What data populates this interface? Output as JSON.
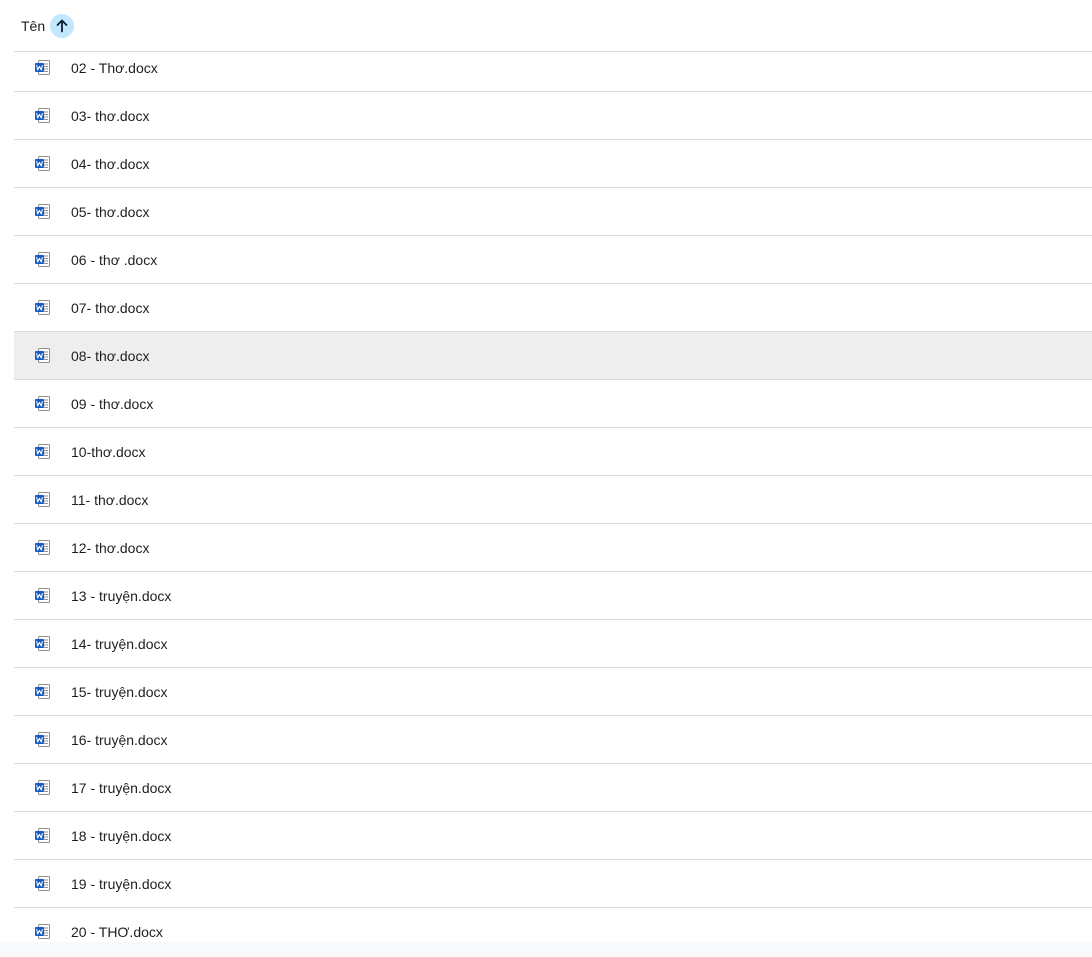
{
  "header": {
    "column_label": "Tên",
    "sort_icon": "arrow-up-icon"
  },
  "files": [
    {
      "name": "02 - Thơ.docx",
      "icon": "word-doc-icon"
    },
    {
      "name": "03- thơ.docx",
      "icon": "word-doc-icon"
    },
    {
      "name": "04- thơ.docx",
      "icon": "word-doc-icon"
    },
    {
      "name": "05- thơ.docx",
      "icon": "word-doc-icon"
    },
    {
      "name": "06 - thơ .docx",
      "icon": "word-doc-icon"
    },
    {
      "name": "07- thơ.docx",
      "icon": "word-doc-icon"
    },
    {
      "name": "08- thơ.docx",
      "icon": "word-doc-icon",
      "selected": true
    },
    {
      "name": "09 - thơ.docx",
      "icon": "word-doc-icon"
    },
    {
      "name": "10-thơ.docx",
      "icon": "word-doc-icon"
    },
    {
      "name": "11- thơ.docx",
      "icon": "word-doc-icon"
    },
    {
      "name": "12- thơ.docx",
      "icon": "word-doc-icon"
    },
    {
      "name": "13 - truyện.docx",
      "icon": "word-doc-icon"
    },
    {
      "name": "14- truyện.docx",
      "icon": "word-doc-icon"
    },
    {
      "name": "15- truyện.docx",
      "icon": "word-doc-icon"
    },
    {
      "name": "16- truyện.docx",
      "icon": "word-doc-icon"
    },
    {
      "name": "17 - truyện.docx",
      "icon": "word-doc-icon"
    },
    {
      "name": "18 - truyện.docx",
      "icon": "word-doc-icon"
    },
    {
      "name": "19 - truyện.docx",
      "icon": "word-doc-icon"
    },
    {
      "name": "20 - THƠ.docx",
      "icon": "word-doc-icon"
    }
  ],
  "colors": {
    "word_blue": "#185abd",
    "sort_bg": "#c2e7ff",
    "selected_row": "#eeeeee",
    "divider": "#dadce0"
  }
}
